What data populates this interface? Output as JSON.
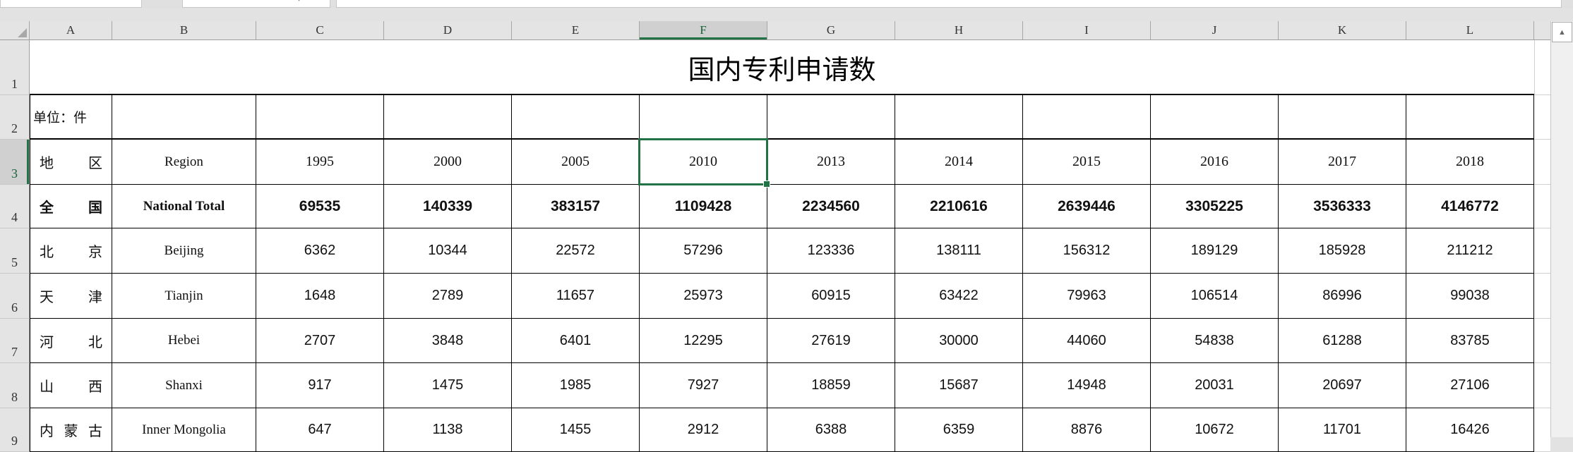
{
  "colors": {
    "selection_green": "#217346",
    "selection_header_text": "#17613a",
    "header_bg": "#e4e4e4",
    "selected_header_bg": "#d0d0d0",
    "grid_black": "#000000",
    "header_grid_gray": "#9d9d9d",
    "light_grid_gray": "#d0d0d0",
    "canvas_gray": "#e2e2e2"
  },
  "icons": {
    "scroll_up_arrow": "▲",
    "select_all_triangle": "corner-triangle",
    "formula_bar_chevron": "▾"
  },
  "columns": {
    "letters": [
      "A",
      "B",
      "C",
      "D",
      "E",
      "F",
      "G",
      "H",
      "I",
      "J",
      "K",
      "L"
    ],
    "selected_letter": "F",
    "widths": [
      117,
      204,
      181,
      181,
      181,
      181,
      181,
      181,
      181,
      181,
      181,
      181
    ],
    "sliver_width": 23
  },
  "rows": {
    "numbers": [
      "1",
      "2",
      "3",
      "4",
      "5",
      "6",
      "7",
      "8",
      "9"
    ],
    "selected_number": "3",
    "heights": [
      78,
      63,
      64,
      62,
      64,
      64,
      63,
      64,
      62
    ]
  },
  "sheet": {
    "title": "国内专利申请数",
    "unit_label": "单位：件",
    "selection": {
      "cell": "F3",
      "value": "2010"
    },
    "header_row": {
      "region_zh": "地区",
      "region_en": "Region",
      "years": [
        "1995",
        "2000",
        "2005",
        "2010",
        "2013",
        "2014",
        "2015",
        "2016",
        "2017",
        "2018"
      ]
    },
    "data_rows": [
      {
        "zh": "全国",
        "en": "National Total",
        "bold": true,
        "values": [
          "69535",
          "140339",
          "383157",
          "1109428",
          "2234560",
          "2210616",
          "2639446",
          "3305225",
          "3536333",
          "4146772"
        ]
      },
      {
        "zh": "北京",
        "en": "Beijing",
        "bold": false,
        "values": [
          "6362",
          "10344",
          "22572",
          "57296",
          "123336",
          "138111",
          "156312",
          "189129",
          "185928",
          "211212"
        ]
      },
      {
        "zh": "天津",
        "en": "Tianjin",
        "bold": false,
        "values": [
          "1648",
          "2789",
          "11657",
          "25973",
          "60915",
          "63422",
          "79963",
          "106514",
          "86996",
          "99038"
        ]
      },
      {
        "zh": "河北",
        "en": "Hebei",
        "bold": false,
        "values": [
          "2707",
          "3848",
          "6401",
          "12295",
          "27619",
          "30000",
          "44060",
          "54838",
          "61288",
          "83785"
        ]
      },
      {
        "zh": "山西",
        "en": "Shanxi",
        "bold": false,
        "values": [
          "917",
          "1475",
          "1985",
          "7927",
          "18859",
          "15687",
          "14948",
          "20031",
          "20697",
          "27106"
        ]
      },
      {
        "zh": "内蒙古",
        "en": "Inner Mongolia",
        "bold": false,
        "values": [
          "647",
          "1138",
          "1455",
          "2912",
          "6388",
          "6359",
          "8876",
          "10672",
          "11701",
          "16426"
        ]
      }
    ]
  }
}
